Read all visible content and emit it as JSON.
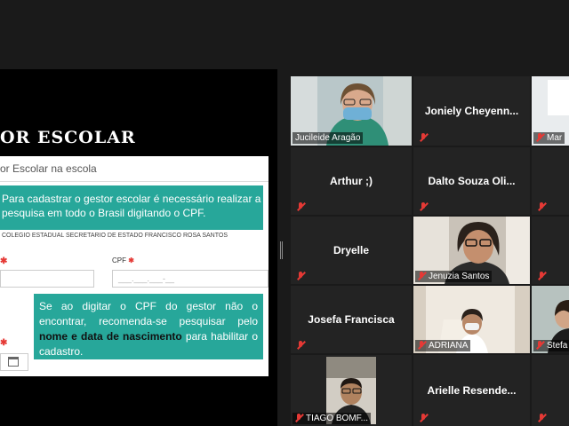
{
  "slide": {
    "title": "OR ESCOLAR",
    "form_header": "or Escolar na escola",
    "tip1": "Para cadastrar o gestor escolar é necessário realizar a pesquisa em todo o Brasil digitando o CPF.",
    "school": "COLEGIO ESTADUAL SECRETARIO DE ESTADO FRANCISCO ROSA SANTOS",
    "cpf_label": "CPF",
    "cpf_placeholder": "___.___.___-__",
    "tip2_a": "Se ao digitar o CPF do gestor não o encontrar, recomenda-se pesquisar pelo ",
    "tip2_b": "nome e data de nascimento",
    "tip2_c": " para habilitar o cadastro.",
    "required_mark": "✱"
  },
  "participants": [
    {
      "name": "Jucileide Aragão",
      "video": true
    },
    {
      "name": "Joniely Cheyenn...",
      "video": false
    },
    {
      "name": "Mar",
      "video": true
    },
    {
      "name": "Arthur ;)",
      "video": false
    },
    {
      "name": "Dalto Souza Oli...",
      "video": false
    },
    {
      "name": "Dryelle",
      "video": false
    },
    {
      "name": "Jenuzia Santos",
      "video": true
    },
    {
      "name": "Josefa Francisca",
      "video": false
    },
    {
      "name": "ADRIANA",
      "video": true
    },
    {
      "name": "Stefa",
      "video": true
    },
    {
      "name": "TIAGO BOMF...",
      "video": true
    },
    {
      "name": "Arielle Resende...",
      "video": false
    }
  ]
}
